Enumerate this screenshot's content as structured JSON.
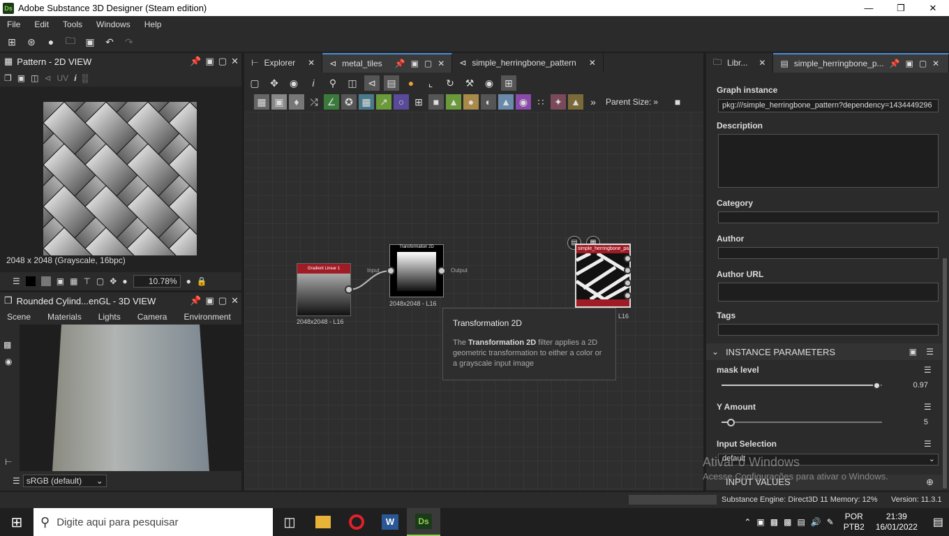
{
  "window": {
    "title": "Adobe Substance 3D Designer (Steam edition)",
    "logo": "Ds"
  },
  "menu": [
    "File",
    "Edit",
    "Tools",
    "Windows",
    "Help"
  ],
  "view2d": {
    "title": "Pattern - 2D VIEW",
    "uv_label": "UV",
    "info": "2048 x 2048 (Grayscale, 16bpc)",
    "zoom": "10.78%"
  },
  "view3d": {
    "title": "Rounded Cylind...enGL - 3D VIEW",
    "menu": [
      "Scene",
      "Materials",
      "Lights",
      "Camera",
      "Environment"
    ],
    "colorspace": "sRGB (default)"
  },
  "graph": {
    "tabs": [
      "Explorer",
      "metal_tiles",
      "simple_herringbone_pattern"
    ],
    "parent_size": "Parent Size:",
    "nodes": {
      "gradient": {
        "title": "Gradient Linear 1",
        "size": "2048x2048 - L16"
      },
      "transform": {
        "title": "Transformation 2D",
        "size": "2048x2048 - L16",
        "input": "Input",
        "output": "Output"
      },
      "herringbone": {
        "title": "simple_herringbone_pa...",
        "size": "L16"
      }
    },
    "tooltip": {
      "title": "Transformation 2D",
      "body_pre": "The ",
      "body_bold": "Transformation 2D",
      "body_post": " filter applies a 2D geometric transformation to either a color or a grayscale input image"
    }
  },
  "props": {
    "tabs": [
      "Libr...",
      "simple_herringbone_p..."
    ],
    "graph_instance_label": "Graph instance",
    "graph_instance_value": "pkg:///simple_herringbone_pattern?dependency=1434449296",
    "description_label": "Description",
    "category_label": "Category",
    "author_label": "Author",
    "author_url_label": "Author URL",
    "tags_label": "Tags",
    "section_instance": "INSTANCE PARAMETERS",
    "mask_level": {
      "label": "mask level",
      "value": "0.97",
      "fraction": 0.97
    },
    "y_amount": {
      "label": "Y Amount",
      "value": "5",
      "fraction": 0.06
    },
    "input_selection": {
      "label": "Input Selection",
      "value": "default"
    },
    "section_input": "INPUT VALUES"
  },
  "watermark": {
    "line1": "Ativar o Windows",
    "line2": "Acesse Configurações para ativar o Windows."
  },
  "status": {
    "engine": "Substance Engine: Direct3D 11  Memory: 12%",
    "version": "Version: 11.3.1"
  },
  "taskbar": {
    "search_placeholder": "Digite aqui para pesquisar",
    "lang1": "POR",
    "lang2": "PTB2",
    "time": "21:39",
    "date": "16/01/2022"
  }
}
